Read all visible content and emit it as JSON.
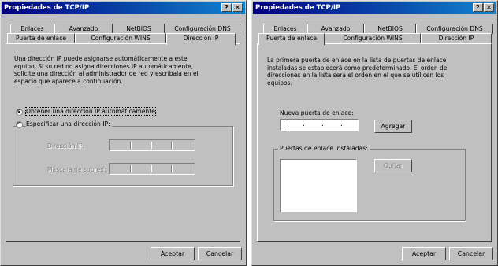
{
  "dialog_left": {
    "title": "Propiedades de TCP/IP",
    "help_btn": "?",
    "close_btn": "✕",
    "tabs_back": [
      "Enlaces",
      "Avanzado",
      "NetBIOS",
      "Configuración DNS"
    ],
    "tabs_front": [
      "Puerta de enlace",
      "Configuración WINS",
      "Dirección IP"
    ],
    "active_tab": "Dirección IP",
    "description": "Una dirección IP puede asignarse automáticamente a este\nequipo. Si su red no asigna direcciones IP automáticamente,\nsolicite una dirección al administrador de red y escríbala en el\nespacio que aparece a continuación.",
    "radio_auto_label": "Obtener una dirección IP automáticamente",
    "radio_manual_label": "Especificar una dirección IP:",
    "ip_address_label": "Dirección IP:",
    "subnet_mask_label": "Máscara de subred:",
    "ok_button": "Aceptar",
    "cancel_button": "Cancelar"
  },
  "dialog_right": {
    "title": "Propiedades de TCP/IP",
    "help_btn": "?",
    "close_btn": "✕",
    "tabs_back": [
      "Enlaces",
      "Avanzado",
      "NetBIOS",
      "Configuración DNS"
    ],
    "tabs_front": [
      "Puerta de enlace",
      "Configuración WINS",
      "Dirección IP"
    ],
    "active_tab": "Puerta de enlace",
    "description": "La primera puerta de enlace en la lista de puertas de enlace\ninstaladas se establecerá como predeterminado. El orden de\ndirecciones en la lista será el orden en el que se utilicen los\nequipos.",
    "new_gateway_label": "Nueva puerta de enlace:",
    "add_button": "Agregar",
    "installed_label": "Puertas de enlace instaladas:",
    "remove_button": "Quitar",
    "ok_button": "Aceptar",
    "cancel_button": "Cancelar"
  },
  "colors": {
    "title_gradient_start": "#000080",
    "title_gradient_end": "#1084d0",
    "face": "#c0c0c0"
  }
}
